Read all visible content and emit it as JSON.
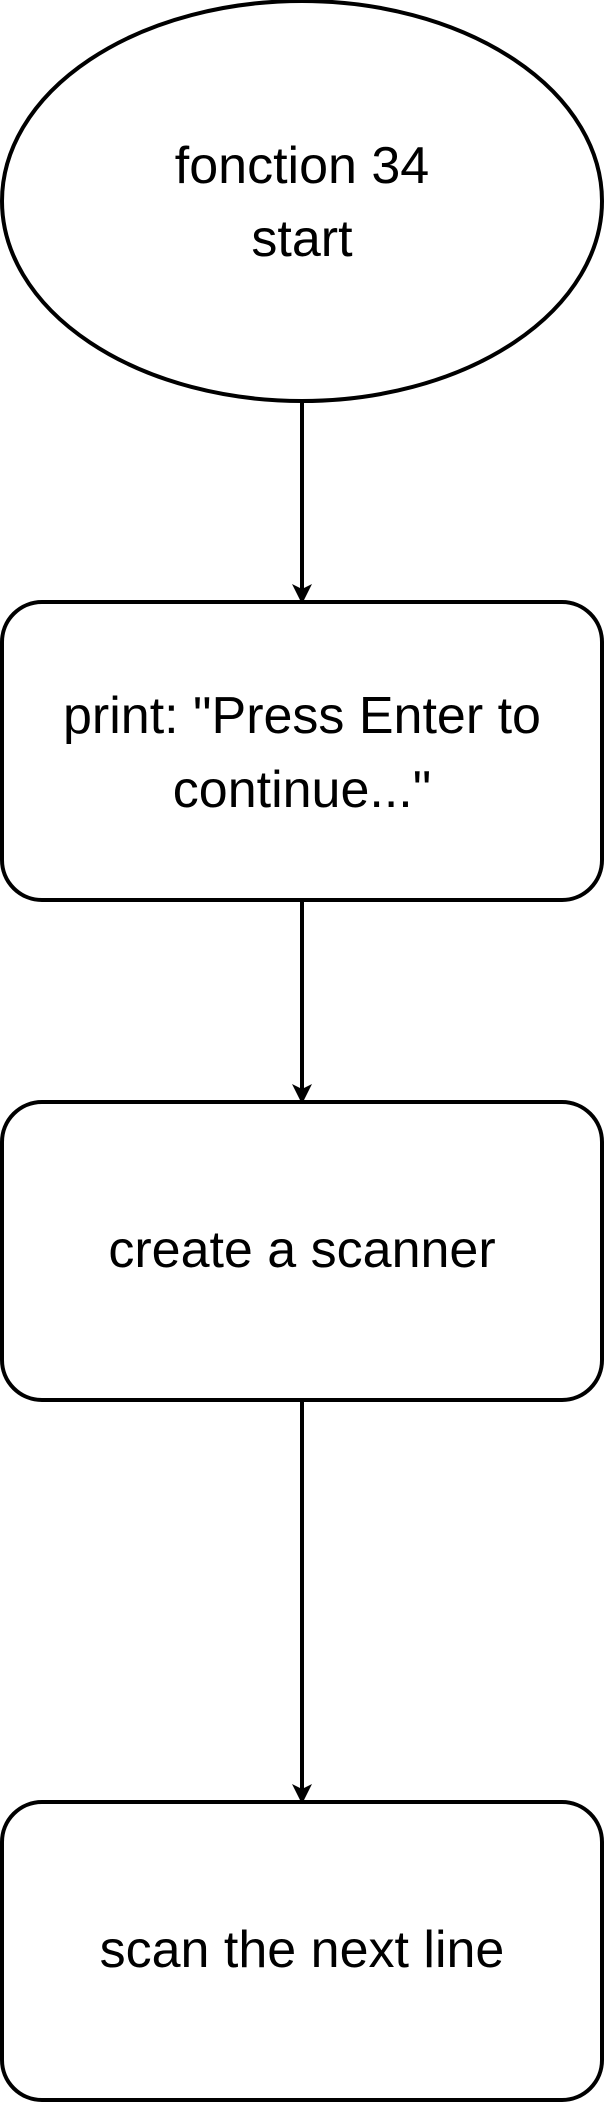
{
  "nodes": [
    {
      "id": "start",
      "shape": "ellipse",
      "lines": [
        "fonction 34",
        "start"
      ]
    },
    {
      "id": "print",
      "shape": "rounded-rect",
      "lines": [
        "print: \"Press Enter to",
        "continue...\""
      ]
    },
    {
      "id": "scanner",
      "shape": "rounded-rect",
      "lines": [
        "create a scanner"
      ]
    },
    {
      "id": "scan",
      "shape": "rounded-rect",
      "lines": [
        "scan the next line"
      ]
    }
  ],
  "edges": [
    {
      "from": "start",
      "to": "print"
    },
    {
      "from": "print",
      "to": "scanner"
    },
    {
      "from": "scanner",
      "to": "scan"
    }
  ]
}
